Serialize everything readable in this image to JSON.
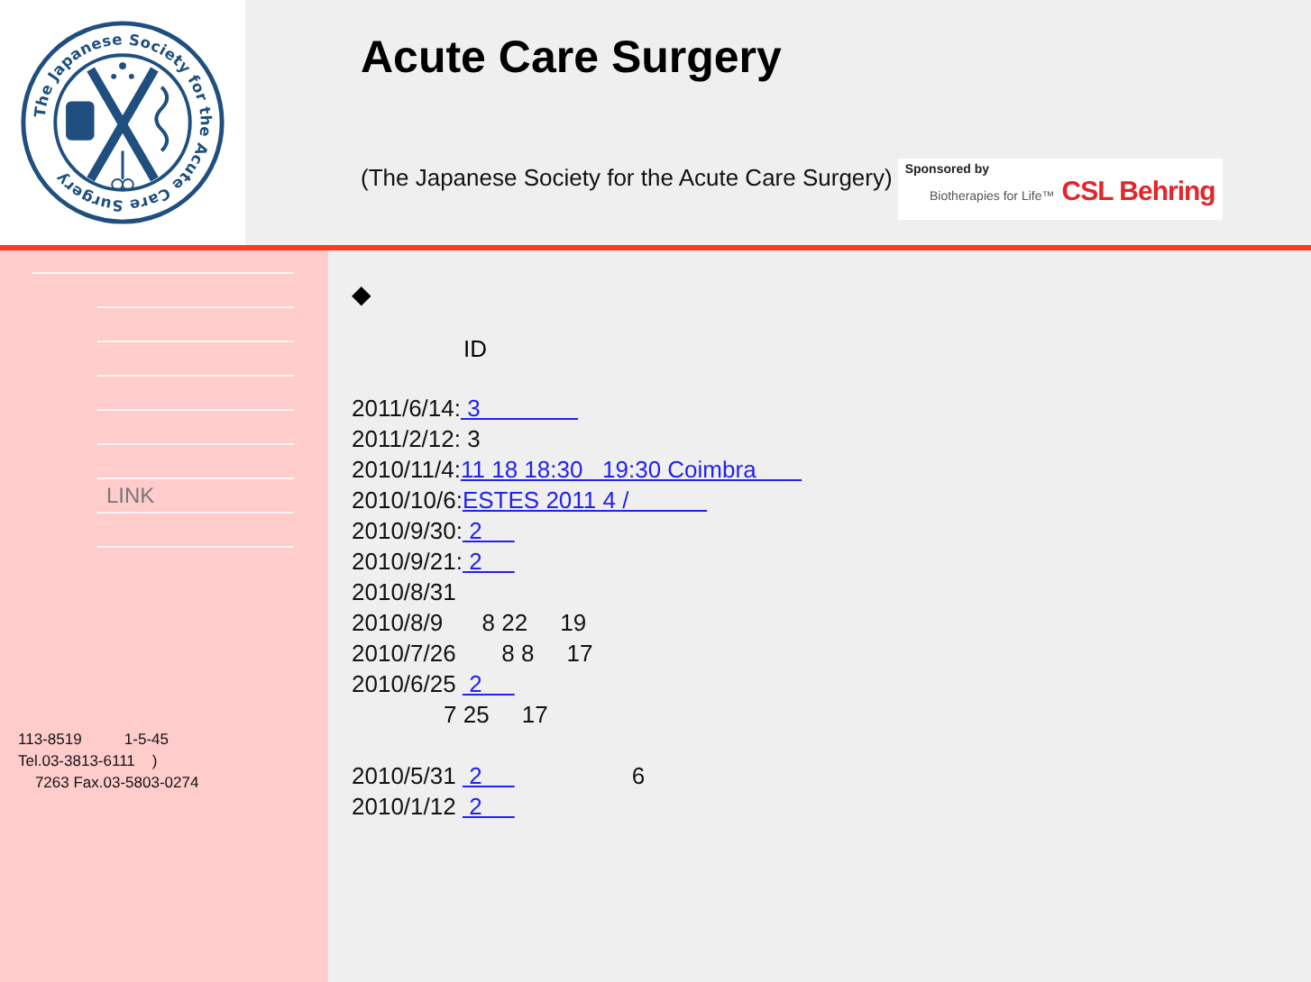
{
  "logo": {
    "ring_text": "The Japanese Society for the Acute Care Surgery"
  },
  "header": {
    "title": "Acute Care Surgery",
    "subtitle": "(The Japanese Society for the Acute Care Surgery)"
  },
  "sponsor": {
    "label": "Sponsored by",
    "tagline": "Biotherapies for Life™",
    "name": "CSL Behring"
  },
  "sidebar": {
    "items": [
      {
        "label": "LINK"
      }
    ],
    "address": [
      "113-8519          1-5-45",
      "Tel.03-3813-6111    )",
      "    7263 Fax.03-5803-0274"
    ]
  },
  "content": {
    "bullet": "◆",
    "heading": "ID",
    "news": [
      {
        "date": "2011/6/14:",
        "link": " 3               "
      },
      {
        "date": "2011/2/12: 3"
      },
      {
        "date": "2010/11/4:",
        "link": "11 18 18:30   19:30 Coimbra       "
      },
      {
        "date": "2010/10/6:",
        "link": "ESTES 2011 4 /            "
      },
      {
        "date": "2010/9/30:",
        "link": " 2     "
      },
      {
        "date": "2010/9/21:",
        "link": " 2     "
      },
      {
        "date": "2010/8/31"
      },
      {
        "date": "2010/8/9      8 22     19"
      },
      {
        "date": "2010/7/26       8 8     17"
      },
      {
        "date": "2010/6/25 ",
        "link": " 2     ",
        "note": "7 25     17"
      },
      {
        "date": "2010/5/31 ",
        "link": " 2     ",
        "after": "                  6"
      },
      {
        "date": "2010/1/12 ",
        "link": " 2     "
      }
    ]
  }
}
